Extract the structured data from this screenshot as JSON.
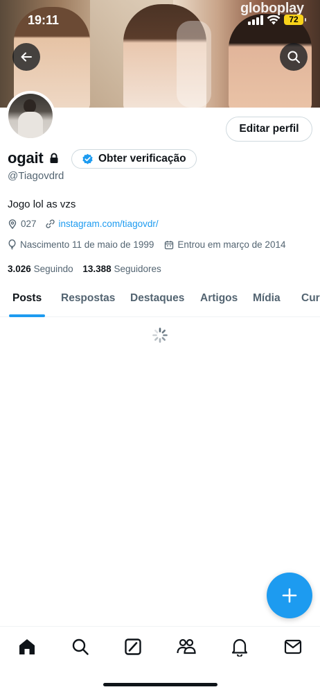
{
  "status_bar": {
    "time": "19:11",
    "battery": "72",
    "watermark": "globoplay"
  },
  "profile": {
    "display_name": "ogait",
    "handle": "@Tiagovdrd",
    "bio": "Jogo lol as vzs",
    "location": "027",
    "website": "instagram.com/tiagovdr/",
    "birthday": "Nascimento 11 de maio de 1999",
    "joined": "Entrou em março de 2014",
    "following_count": "3.026",
    "following_label": "Seguindo",
    "followers_count": "13.388",
    "followers_label": "Seguidores"
  },
  "buttons": {
    "edit_profile": "Editar perfil",
    "get_verified": "Obter verificação"
  },
  "tabs": [
    {
      "label": "Posts",
      "active": true
    },
    {
      "label": "Respostas",
      "active": false
    },
    {
      "label": "Destaques",
      "active": false
    },
    {
      "label": "Artigos",
      "active": false
    },
    {
      "label": "Mídia",
      "active": false
    },
    {
      "label": "Cur",
      "active": false
    }
  ],
  "colors": {
    "accent": "#1d9bf0",
    "text": "#0f1419",
    "secondary_text": "#536471",
    "battery": "#f7d21a"
  },
  "icons": {
    "back": "arrow-left-icon",
    "search": "search-icon",
    "lock": "lock-icon",
    "verified": "verified-badge-icon",
    "location": "location-pin-icon",
    "link": "link-icon",
    "birthday": "balloon-icon",
    "calendar": "calendar-icon",
    "loading": "spinner-icon",
    "compose": "plus-icon",
    "nav": [
      "home-icon",
      "search-icon",
      "grok-icon",
      "communities-icon",
      "notifications-icon",
      "messages-icon"
    ]
  }
}
